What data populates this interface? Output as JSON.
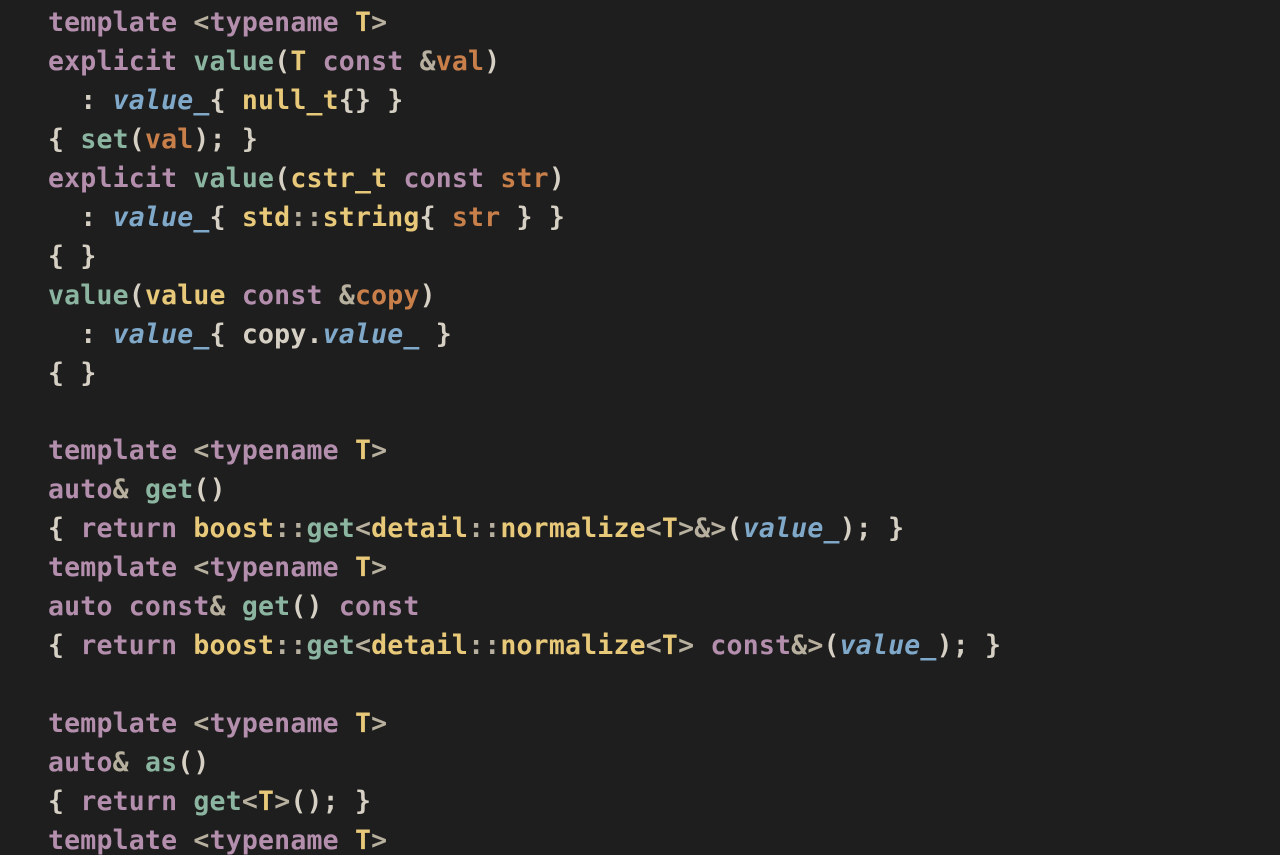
{
  "t": {
    "template": "template",
    "typename": "typename",
    "explicit": "explicit",
    "auto": "auto",
    "const": "const",
    "return": "return",
    "T": "T",
    "value": "value",
    "value_": "value_",
    "null_t": "null_t",
    "set": "set",
    "val": "val",
    "cstr_t": "cstr_t",
    "str": "str",
    "std": "std",
    "string": "string",
    "copy": "copy",
    "get": "get",
    "as": "as",
    "boost": "boost",
    "detail": "detail",
    "normalize": "normalize",
    "amp": "&",
    "lt": "<",
    "gt": ">",
    "lp": "(",
    "rp": ")",
    "lb": "{",
    "rb": "}",
    "colon": ":",
    "dcolon": "::",
    "comma": ",",
    "semi": ";",
    "dot": ".",
    "sp": " ",
    "sp4": "    ",
    "colon_init": "  : "
  }
}
